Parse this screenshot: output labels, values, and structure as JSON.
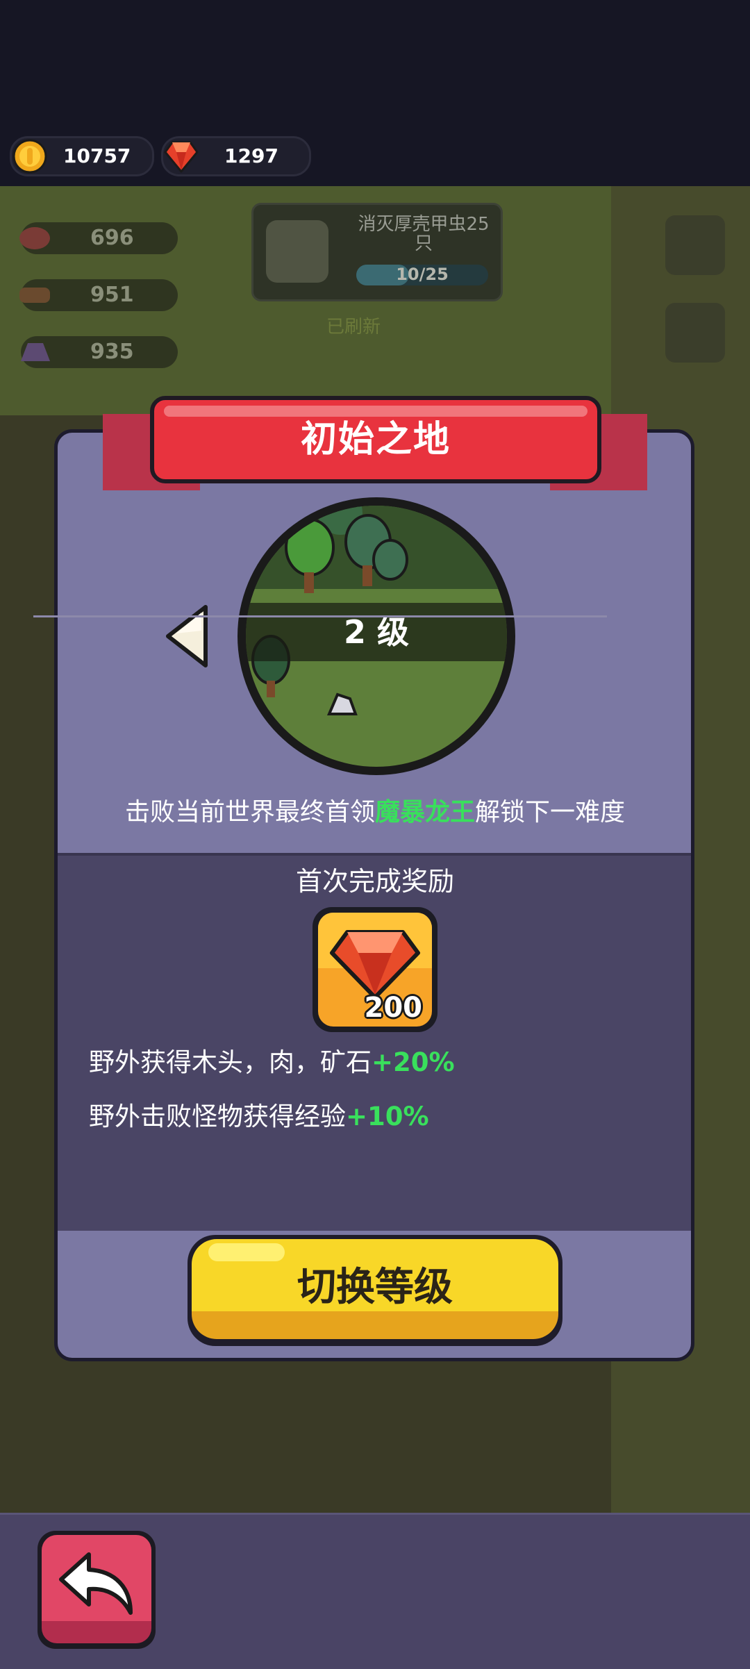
{
  "currency": {
    "coins": "10757",
    "gems": "1297"
  },
  "background": {
    "resources": [
      "696",
      "951",
      "935"
    ],
    "quest_title": "消灭厚壳甲虫25只",
    "quest_progress": "10/25",
    "quest_progress_fraction": 0.4,
    "refreshed_label": "已刷新"
  },
  "modal": {
    "title": "初始之地",
    "level_label": "2 级",
    "description_prefix": "击败当前世界最终首领",
    "boss_name": "魔暴龙王",
    "description_suffix": "解锁下一难度",
    "reward_title": "首次完成奖励",
    "reward_amount": "200",
    "bonuses": [
      {
        "text": "野外获得木头，肉，矿石",
        "value": "+20%"
      },
      {
        "text": "野外击败怪物获得经验",
        "value": "+10%"
      }
    ],
    "switch_button": "切换等级"
  },
  "icons": {
    "coin": "coin-icon",
    "gem": "red-gem-icon",
    "back": "back-arrow-icon",
    "prev": "left-arrow-icon"
  },
  "colors": {
    "banner": "#e8333e",
    "panel": "#7b78a3",
    "panel_lower": "#4a4565",
    "highlight_green": "#39e05c",
    "button_yellow": "#f8d728",
    "back_button": "#e14766"
  }
}
